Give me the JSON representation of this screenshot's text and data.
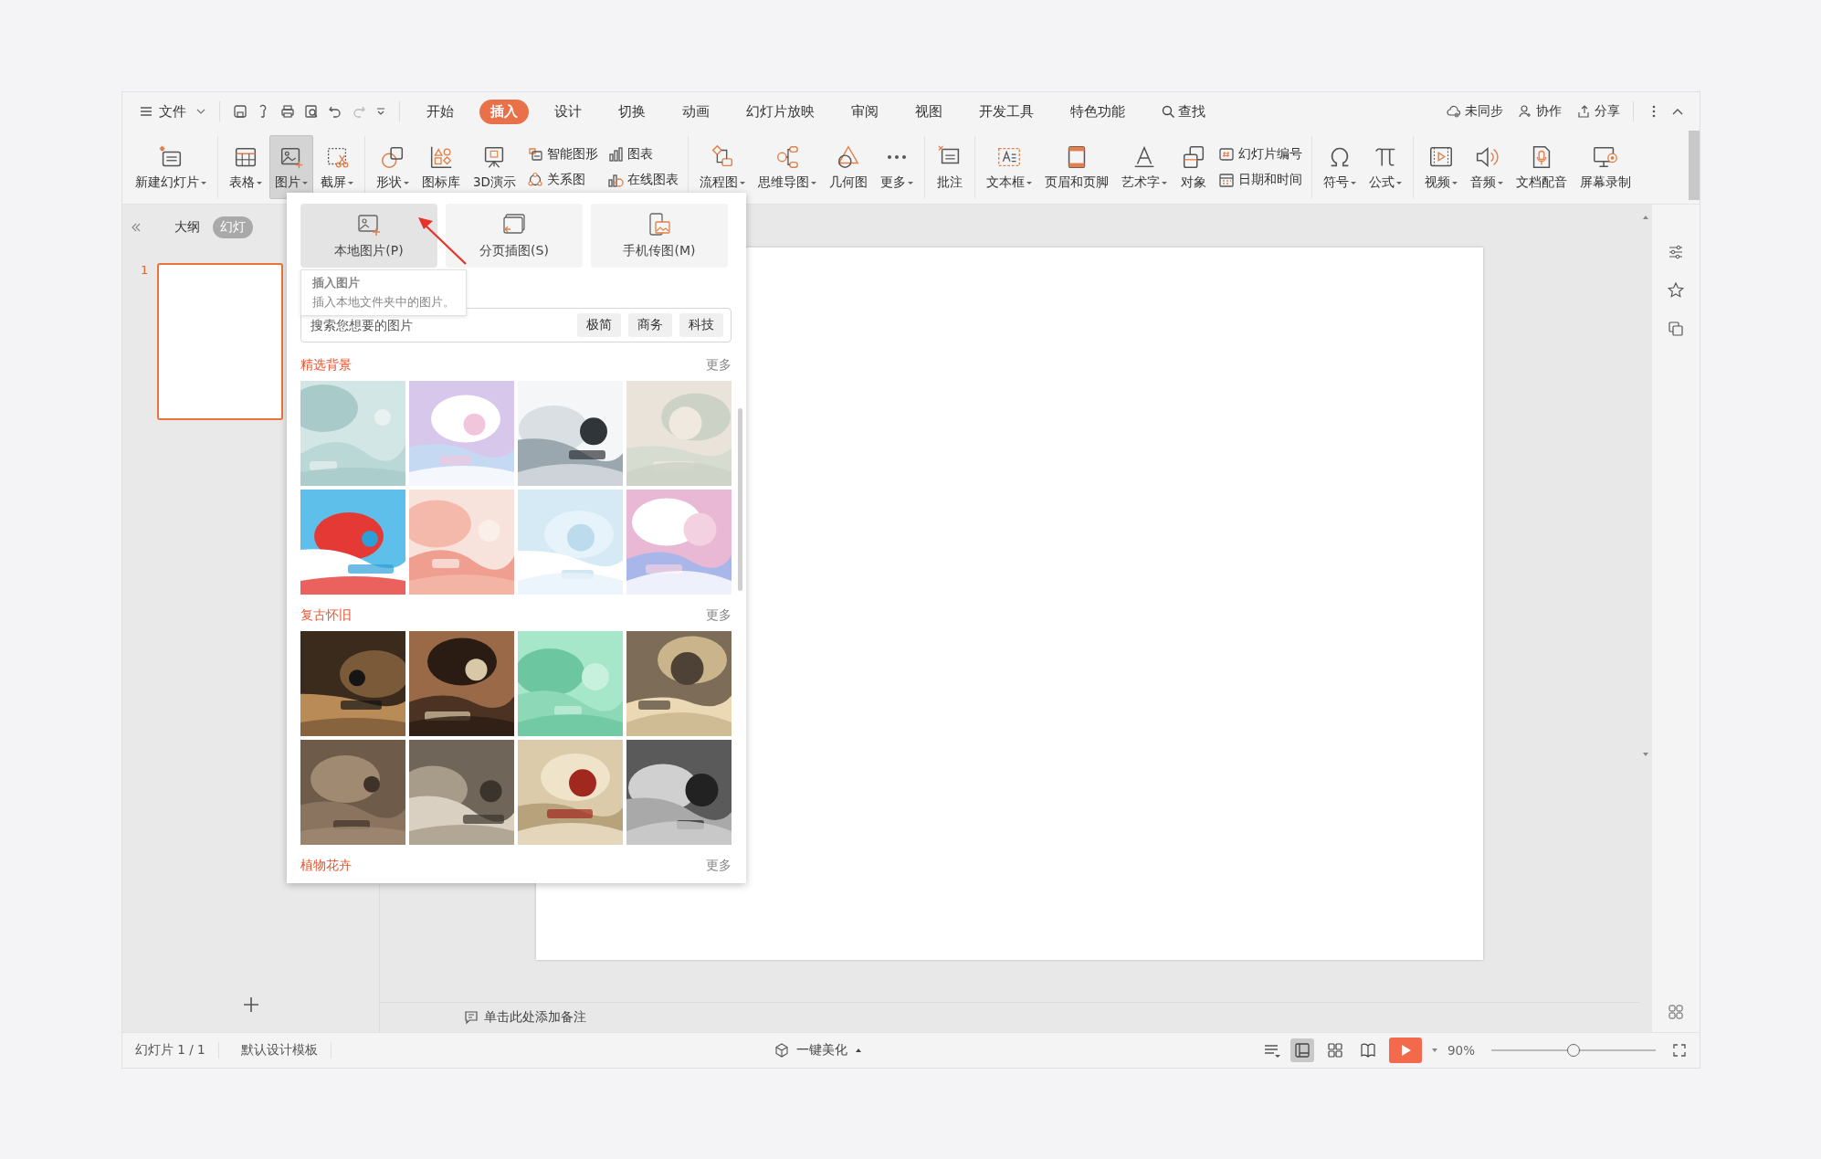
{
  "menu": {
    "file": "文件",
    "tabs": [
      {
        "label": "开始",
        "selected": false
      },
      {
        "label": "插入",
        "selected": true
      },
      {
        "label": "设计",
        "selected": false
      },
      {
        "label": "切换",
        "selected": false
      },
      {
        "label": "动画",
        "selected": false
      },
      {
        "label": "幻灯片放映",
        "selected": false
      },
      {
        "label": "审阅",
        "selected": false
      },
      {
        "label": "视图",
        "selected": false
      },
      {
        "label": "开发工具",
        "selected": false
      },
      {
        "label": "特色功能",
        "selected": false
      }
    ],
    "search": "查找",
    "actions": [
      "未同步",
      "协作",
      "分享"
    ]
  },
  "ribbon": [
    {
      "items": [
        {
          "kind": "big",
          "label": "新建幻灯片",
          "menu": true,
          "selected": false
        }
      ]
    },
    {
      "items": [
        {
          "kind": "big",
          "label": "表格",
          "menu": true,
          "selected": false
        },
        {
          "kind": "big",
          "label": "图片",
          "menu": true,
          "selected": true
        },
        {
          "kind": "big",
          "label": "截屏",
          "menu": true,
          "selected": false
        }
      ]
    },
    {
      "items": [
        {
          "kind": "big",
          "label": "形状",
          "menu": true,
          "selected": false
        },
        {
          "kind": "big",
          "label": "图标库",
          "menu": false,
          "selected": false
        },
        {
          "kind": "big",
          "label": "3D演示",
          "menu": false,
          "selected": false
        },
        {
          "kind": "stack",
          "items": [
            {
              "label": "智能图形"
            },
            {
              "label": "关系图"
            }
          ]
        },
        {
          "kind": "stack",
          "items": [
            {
              "label": "图表"
            },
            {
              "label": "在线图表"
            }
          ]
        }
      ]
    },
    {
      "items": [
        {
          "kind": "big",
          "label": "流程图",
          "menu": true,
          "selected": false
        },
        {
          "kind": "big",
          "label": "思维导图",
          "menu": true,
          "selected": false
        },
        {
          "kind": "big",
          "label": "几何图",
          "menu": false,
          "selected": false
        },
        {
          "kind": "big",
          "label": "更多",
          "menu": true,
          "selected": false
        }
      ]
    },
    {
      "items": [
        {
          "kind": "big",
          "label": "批注",
          "menu": false,
          "selected": false
        }
      ]
    },
    {
      "items": [
        {
          "kind": "big",
          "label": "文本框",
          "menu": true,
          "selected": false
        },
        {
          "kind": "big",
          "label": "页眉和页脚",
          "menu": false,
          "selected": false
        },
        {
          "kind": "big",
          "label": "艺术字",
          "menu": true,
          "selected": false
        },
        {
          "kind": "big",
          "label": "对象",
          "menu": false,
          "selected": false
        },
        {
          "kind": "stack",
          "items": [
            {
              "label": "幻灯片编号"
            },
            {
              "label": "日期和时间"
            }
          ]
        }
      ]
    },
    {
      "items": [
        {
          "kind": "big",
          "label": "符号",
          "menu": true,
          "selected": false
        },
        {
          "kind": "big",
          "label": "公式",
          "menu": true,
          "selected": false
        }
      ]
    },
    {
      "items": [
        {
          "kind": "big",
          "label": "视频",
          "menu": true,
          "selected": false
        },
        {
          "kind": "big",
          "label": "音频",
          "menu": true,
          "selected": false
        },
        {
          "kind": "big",
          "label": "文档配音",
          "menu": false,
          "selected": false
        },
        {
          "kind": "big",
          "label": "屏幕录制",
          "menu": false,
          "selected": false
        }
      ]
    }
  ],
  "left_panel": {
    "tabs": [
      {
        "label": "大纲",
        "selected": false
      },
      {
        "label": "幻灯",
        "selected": true
      }
    ],
    "slides": [
      {
        "number": "1",
        "selected": true
      }
    ]
  },
  "picture_menu": {
    "options": [
      {
        "label": "本地图片(P)",
        "selected": true
      },
      {
        "label": "分页插图(S)",
        "selected": false
      },
      {
        "label": "手机传图(M)",
        "selected": false
      }
    ],
    "tooltip": {
      "title": "插入图片",
      "text": "插入本地文件夹中的图片。"
    },
    "search": {
      "placeholder": "搜索您想要的图片",
      "tags": [
        "极简",
        "商务",
        "科技"
      ]
    },
    "sections": [
      {
        "title": "精选背景",
        "more": "更多"
      },
      {
        "title": "复古怀旧",
        "more": "更多"
      },
      {
        "title": "植物花卉",
        "more": "更多"
      }
    ]
  },
  "notes": {
    "placeholder": "单击此处添加备注"
  },
  "status_bar": {
    "slide": "幻灯片 1 / 1",
    "template": "默认设计模板",
    "beautify": "一键美化",
    "views": [
      {
        "selected": true
      },
      {
        "selected": false
      },
      {
        "selected": false
      }
    ],
    "zoom": "90%",
    "zoom_slider": {
      "level": 0.5
    }
  }
}
